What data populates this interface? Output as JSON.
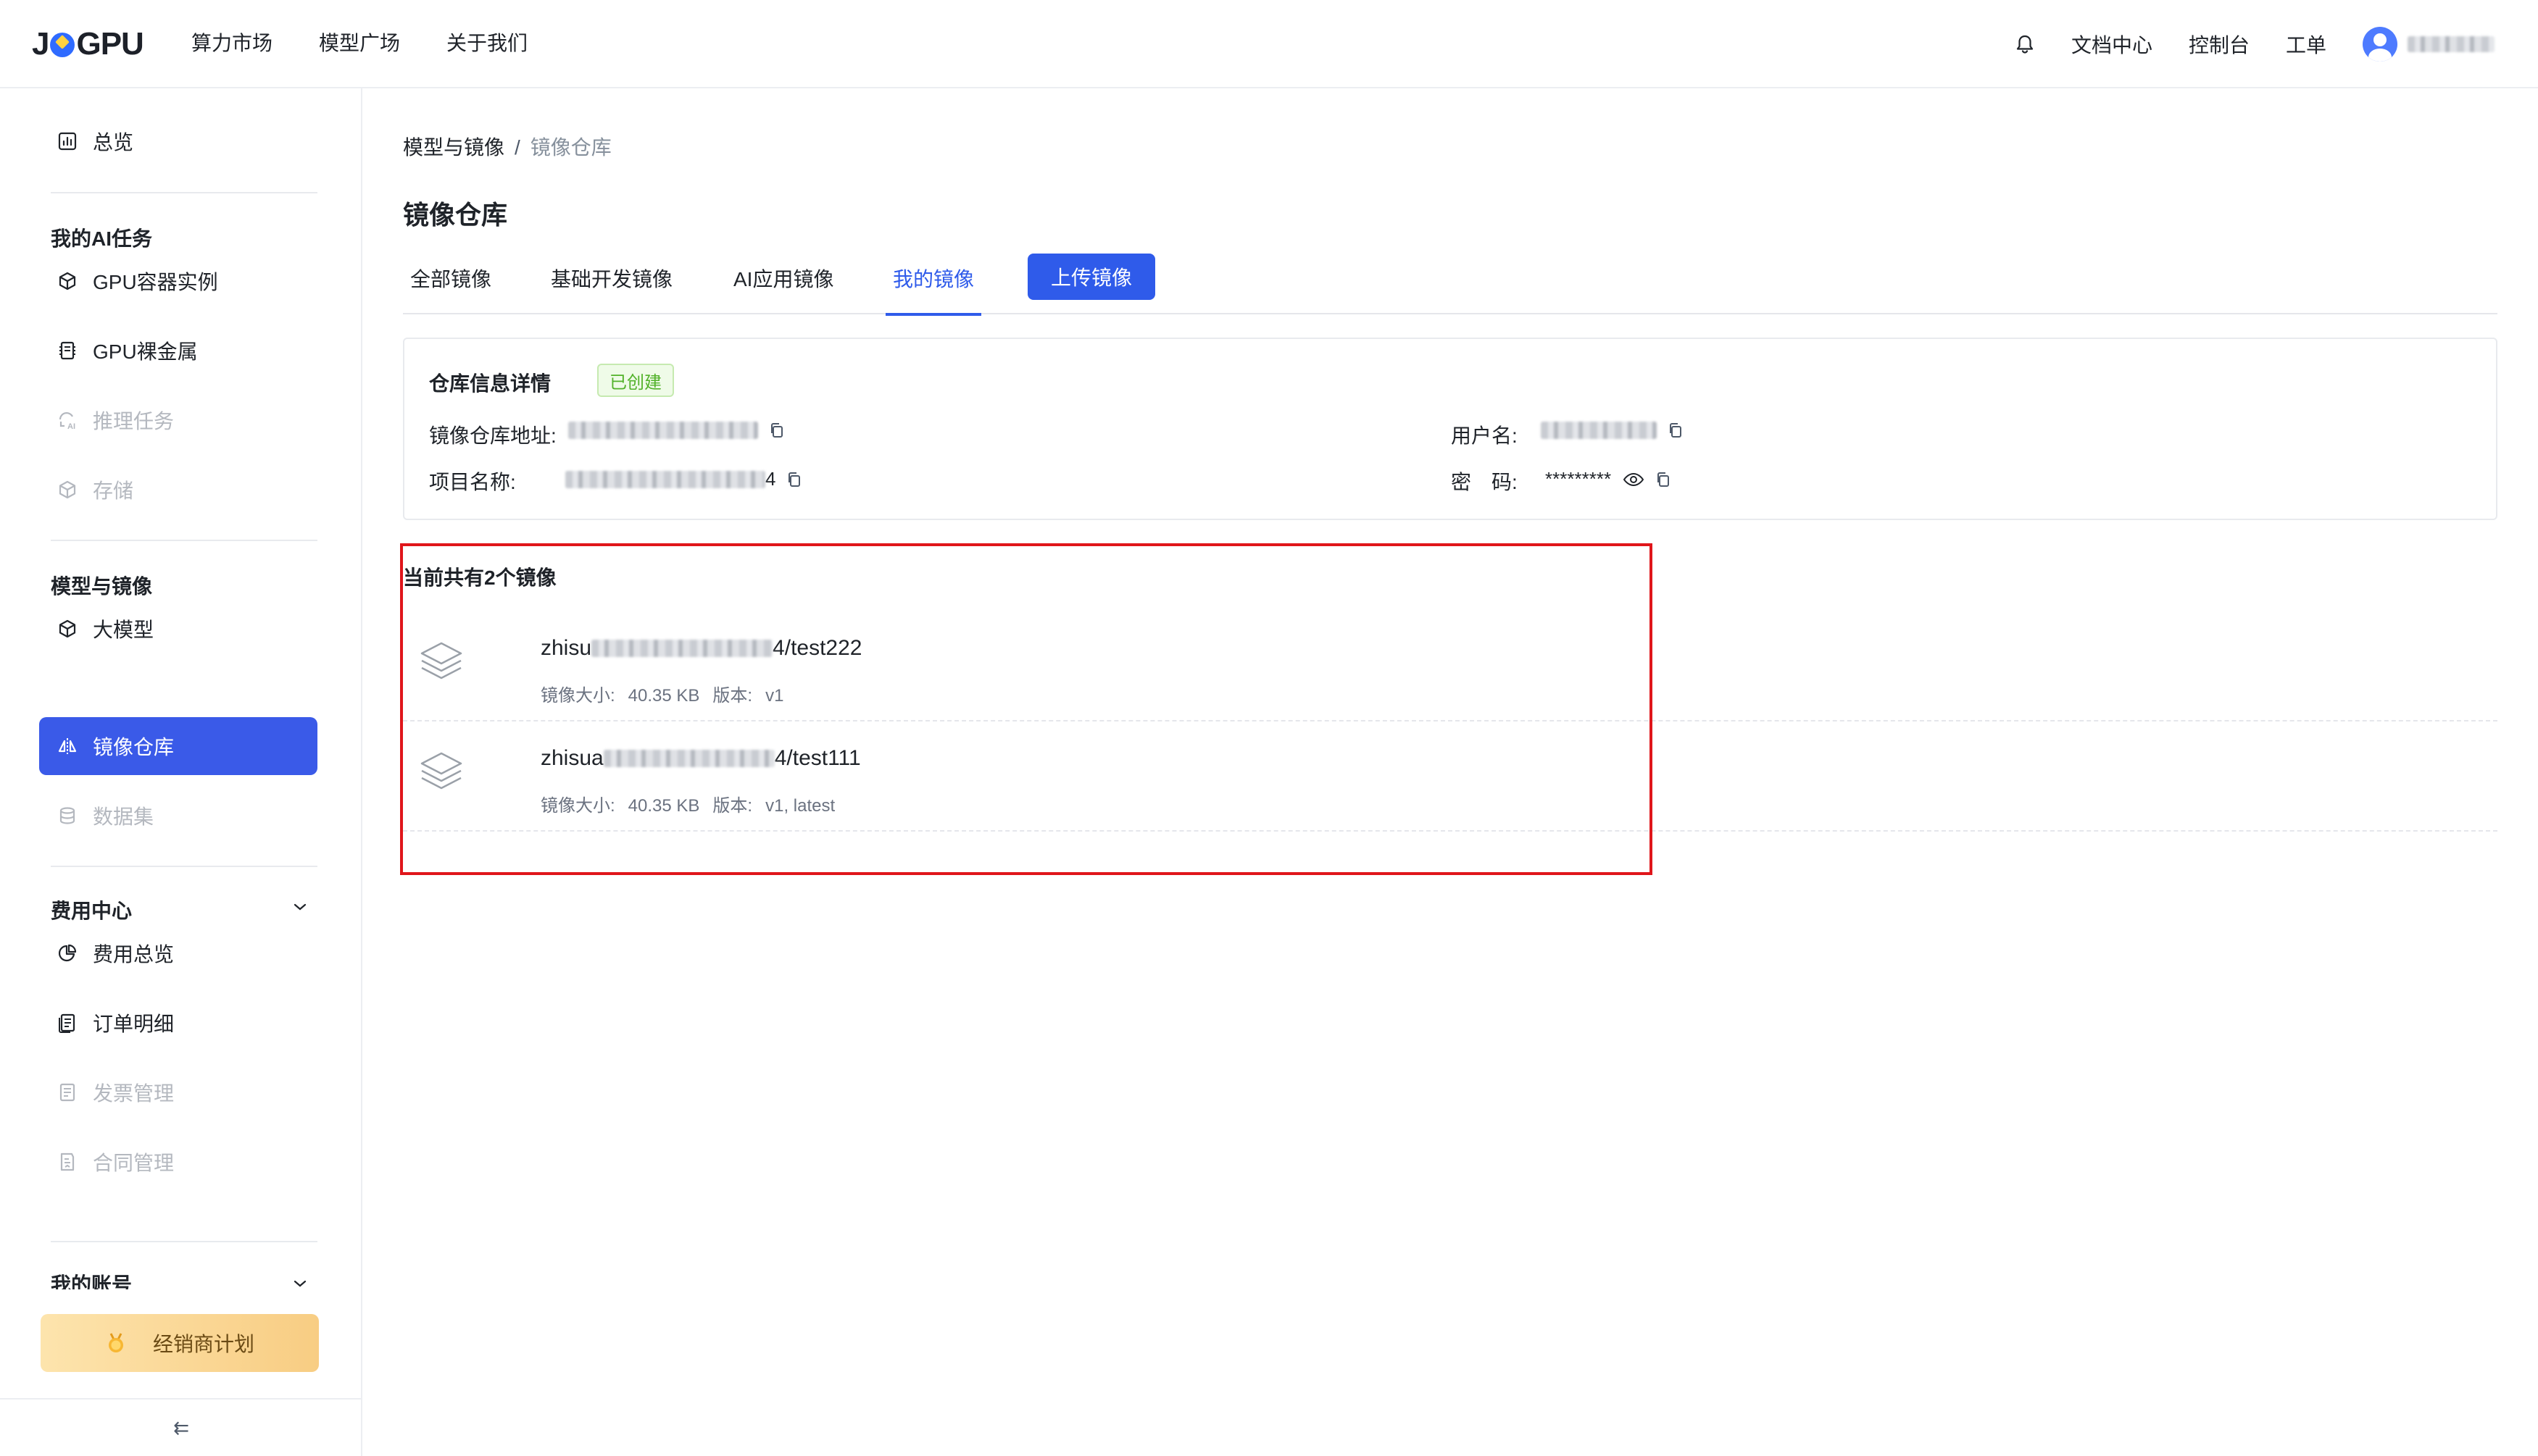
{
  "header": {
    "logo": "J?GPU",
    "nav": [
      "算力市场",
      "模型广场",
      "关于我们"
    ],
    "right_links": [
      "文档中心",
      "控制台",
      "工单"
    ],
    "icons": [
      "bell-icon",
      "user-avatar-icon"
    ]
  },
  "sidebar": {
    "overview": "总览",
    "group_ai_tasks": "我的AI任务",
    "gpu_container": "GPU容器实例",
    "gpu_bare_metal": "GPU裸金属",
    "inference_tasks": "推理任务",
    "storage": "存储",
    "group_models": "模型与镜像",
    "large_model": "大模型",
    "image_repo": "镜像仓库",
    "dataset": "数据集",
    "group_billing": "费用中心",
    "billing_overview": "费用总览",
    "order_details": "订单明细",
    "invoice_mgmt": "发票管理",
    "contract_mgmt": "合同管理",
    "group_account": "我的账号",
    "dealer_plan": "经销商计划",
    "collapse_icon": "⇇"
  },
  "breadcrumb": {
    "parent": "模型与镜像",
    "separator": "/",
    "current": "镜像仓库"
  },
  "page_title": "镜像仓库",
  "tabs": [
    "全部镜像",
    "基础开发镜像",
    "AI应用镜像",
    "我的镜像"
  ],
  "active_tab": "我的镜像",
  "upload_button": "上传镜像",
  "repo_info": {
    "title": "仓库信息详情",
    "status": "已创建",
    "address_label": "镜像仓库地址:",
    "project_label": "项目名称:",
    "project_suffix": "4",
    "username_label": "用户名:",
    "password_label": "密　码:",
    "password_value": "*********"
  },
  "images": {
    "count_text": "当前共有2个镜像",
    "items": [
      {
        "name_prefix": "zhisu",
        "name_suffix": "4/test222",
        "size_label": "镜像大小:",
        "size": "40.35 KB",
        "version_label": "版本:",
        "version": "v1"
      },
      {
        "name_prefix": "zhisua",
        "name_suffix": "4/test111",
        "size_label": "镜像大小:",
        "size": "40.35 KB",
        "version_label": "版本:",
        "version": "v1, latest"
      }
    ]
  },
  "colors": {
    "primary": "#2f5bea",
    "sidebar_active": "#3a5ae8",
    "highlight_border": "#e0161b",
    "success": "#52b22a"
  }
}
